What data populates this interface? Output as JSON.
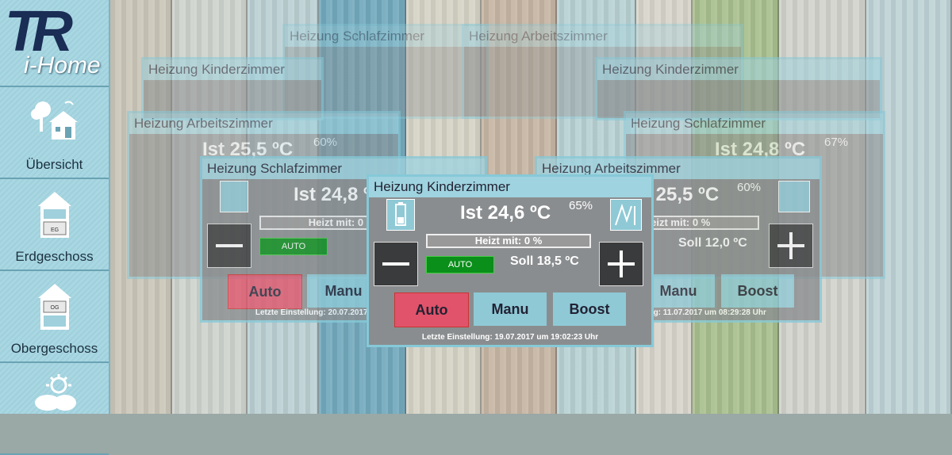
{
  "app": {
    "logo_mark": "TR",
    "logo_text": "i-Home"
  },
  "sidebar": {
    "items": [
      {
        "label": "Übersicht",
        "icon": "house-icon"
      },
      {
        "label": "Erdgeschoss",
        "icon": "floor-eg-icon",
        "badge": "EG"
      },
      {
        "label": "Obergeschoss",
        "icon": "floor-og-icon",
        "badge": "OG"
      },
      {
        "label": "",
        "icon": "weather-icon"
      }
    ]
  },
  "labels": {
    "heizt": "Heizt mit: 0 %",
    "auto_badge": "AUTO",
    "auto": "Auto",
    "manu": "Manu",
    "boost": "Boost"
  },
  "widgets": [
    {
      "title": "Heizung Schlafzimmer",
      "ist": "Ist 24,8 ºC",
      "hum": "67%",
      "soll": "Soll 12,0 ºC",
      "last": "Letzte Einstellung: 20.07.2017 um 08:20:28 Uhr"
    },
    {
      "title": "Heizung Arbeitszimmer",
      "ist": "Ist 25,5 ºC",
      "hum": "60%",
      "soll": "Soll 12,0 ºC",
      "last": "Letzte Einstellung: 11.07.2017 um 08:29:28 Uhr"
    },
    {
      "title": "Heizung Kinderzimmer",
      "ist": "Ist 24,6 ºC",
      "hum": "65%",
      "soll": "Soll 18,5 ºC",
      "last": "Letzte Einstellung: 19.07.2017 um 19:02:23 Uhr"
    }
  ],
  "colors": {
    "accent": "#86c9d8",
    "auto": "#e0536a",
    "auto_badge": "#0a8f1a",
    "logo": "#1a2d55"
  }
}
